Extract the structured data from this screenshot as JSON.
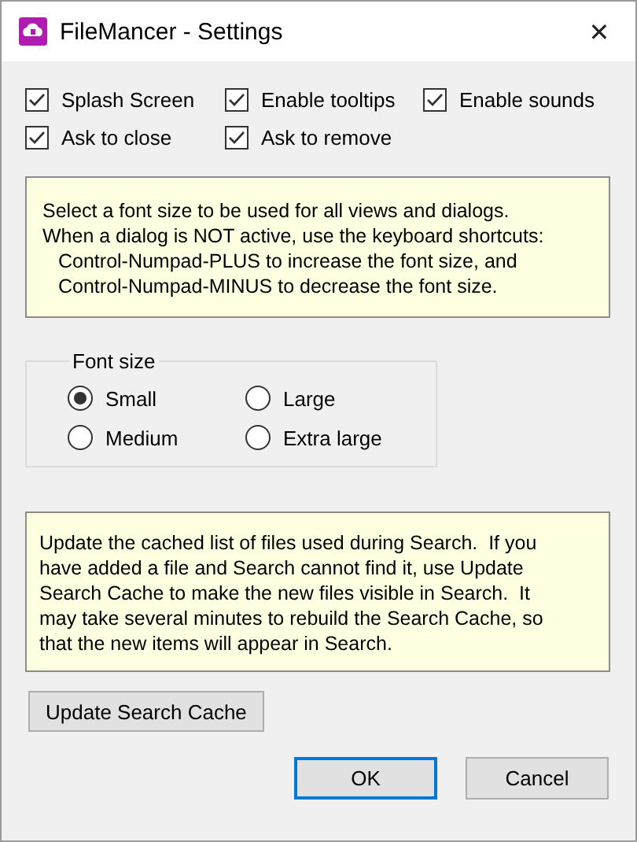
{
  "window": {
    "title": "FileMancer - Settings",
    "close": "✕"
  },
  "options": [
    {
      "label": "Splash Screen",
      "checked": true
    },
    {
      "label": "Enable tooltips",
      "checked": true
    },
    {
      "label": "Enable sounds",
      "checked": true
    },
    {
      "label": "Ask to close",
      "checked": true
    },
    {
      "label": "Ask to remove",
      "checked": true
    }
  ],
  "font_note": [
    {
      "text": "Select a font size to be used for all views and dialogs.",
      "indent": false
    },
    {
      "text": "When a dialog is NOT active, use the keyboard shortcuts:",
      "indent": false
    },
    {
      "text": "Control-Numpad-PLUS to increase the font size, and",
      "indent": true
    },
    {
      "text": "Control-Numpad-MINUS to decrease the font size.",
      "indent": true
    }
  ],
  "font_size": {
    "legend": "Font size",
    "options": [
      {
        "label": "Small",
        "selected": true
      },
      {
        "label": "Large",
        "selected": false
      },
      {
        "label": "Medium",
        "selected": false
      },
      {
        "label": "Extra large",
        "selected": false
      }
    ]
  },
  "cache_note": [
    {
      "text": "Update the cached list of files used during Search.  If you",
      "indent": false
    },
    {
      "text": "have added a file and Search cannot find it, use Update",
      "indent": false
    },
    {
      "text": "Search Cache to make the new files visible in Search.  It",
      "indent": false
    },
    {
      "text": "may take several minutes to rebuild the Search Cache, so",
      "indent": false
    },
    {
      "text": "that the new items will appear in Search.",
      "indent": false
    }
  ],
  "update_button": "Update Search Cache",
  "buttons": [
    {
      "label": "OK",
      "default": true
    },
    {
      "label": "Cancel",
      "default": false
    }
  ]
}
